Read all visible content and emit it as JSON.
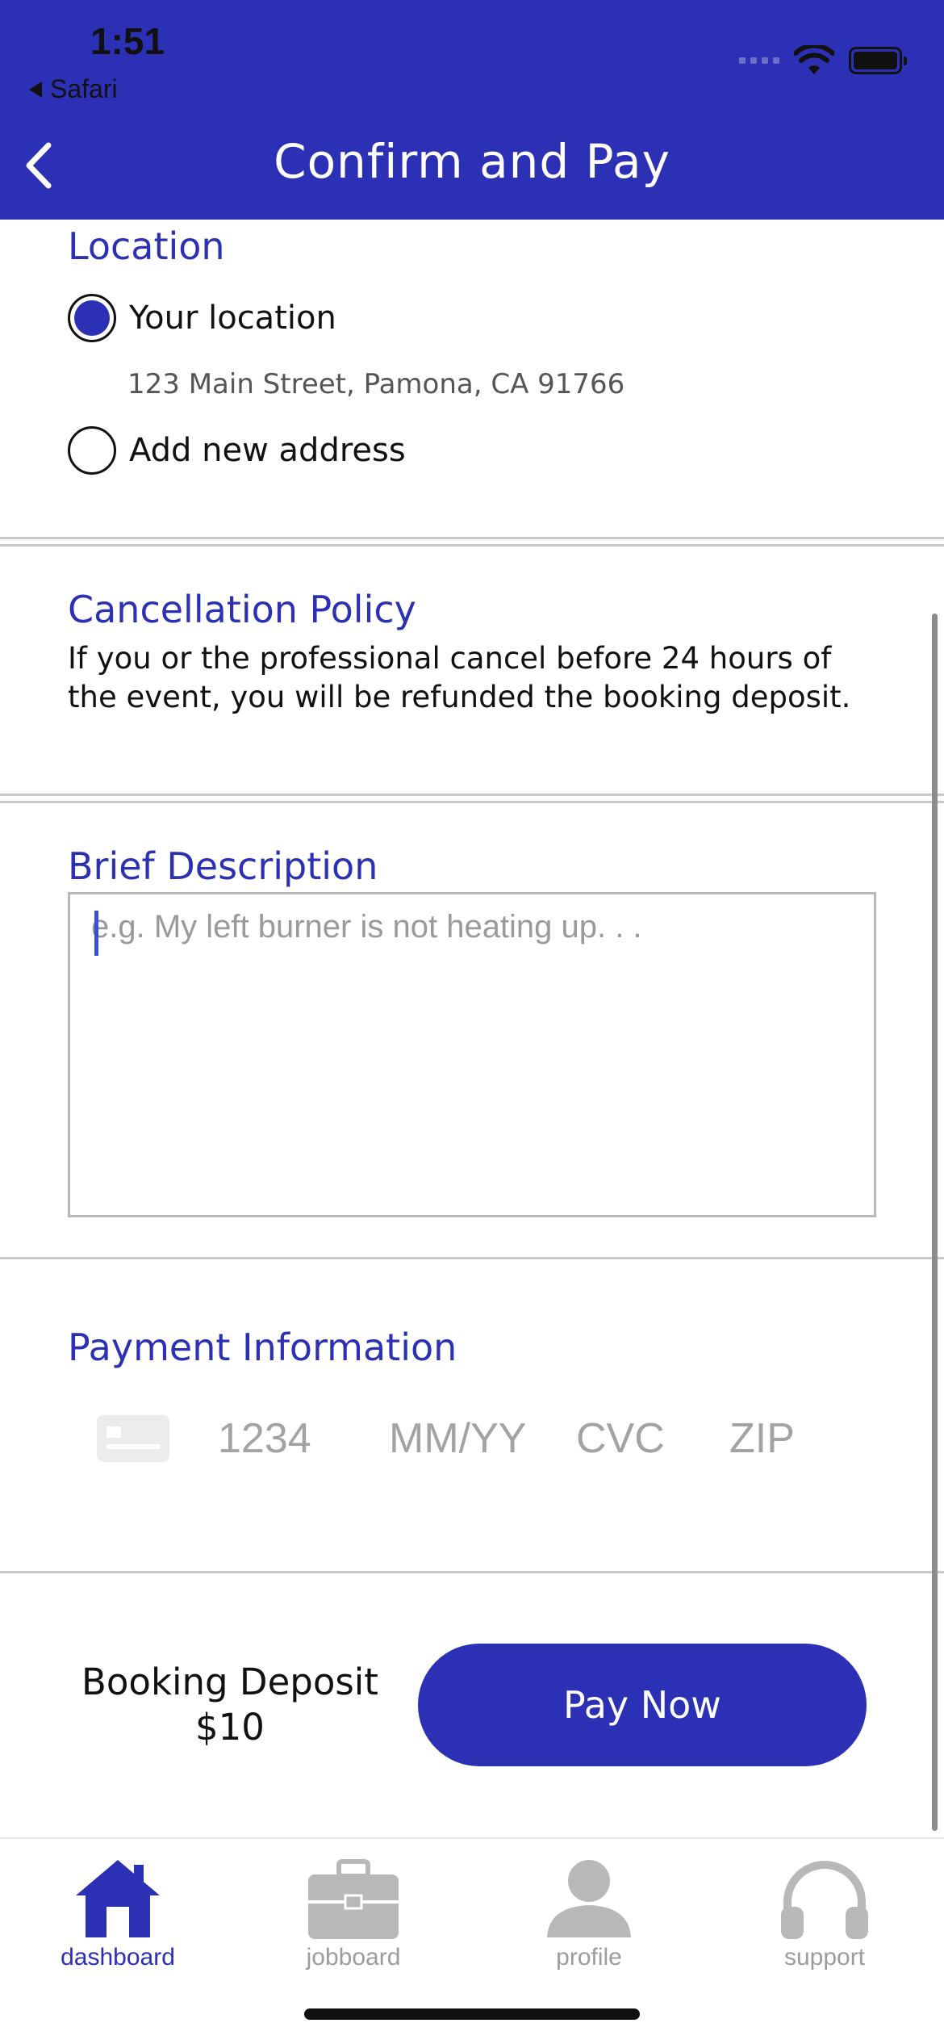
{
  "status_bar": {
    "time": "1:51",
    "back_app": "Safari"
  },
  "nav": {
    "title": "Confirm and Pay"
  },
  "location": {
    "title": "Location",
    "option_current": "Your location",
    "address": "123 Main Street, Pamona, CA 91766",
    "option_new": "Add new address",
    "selected": "Your location"
  },
  "cancellation": {
    "title": "Cancellation Policy",
    "text": "If you or the professional cancel before 24 hours of the event, you will be refunded the booking deposit."
  },
  "description": {
    "title": "Brief Description",
    "placeholder": "e.g. My left burner is not heating up. . .",
    "value": ""
  },
  "payment": {
    "title": "Payment Information",
    "card_number_placeholder": "1234",
    "expiry_placeholder": "MM/YY",
    "cvc_placeholder": "CVC",
    "zip_placeholder": "ZIP"
  },
  "footer": {
    "deposit_label": "Booking Deposit",
    "deposit_amount": "$10",
    "pay_button": "Pay Now"
  },
  "tabs": [
    {
      "label": "dashboard",
      "icon": "house-icon",
      "active": true
    },
    {
      "label": "jobboard",
      "icon": "briefcase-icon",
      "active": false
    },
    {
      "label": "profile",
      "icon": "person-icon",
      "active": false
    },
    {
      "label": "support",
      "icon": "headphones-icon",
      "active": false
    }
  ],
  "colors": {
    "brand": "#2b30b5",
    "inactive": "#9c9c9c"
  }
}
